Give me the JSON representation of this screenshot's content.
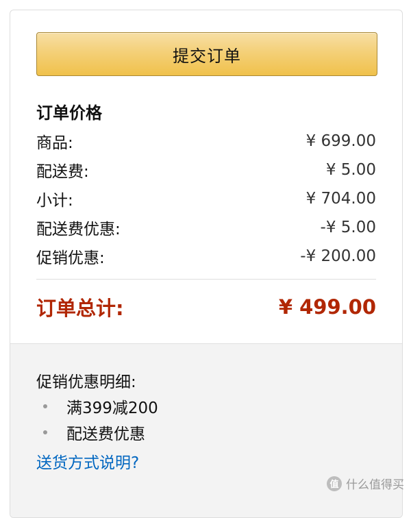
{
  "order": {
    "submit_label": "提交订单",
    "section_title": "订单价格",
    "rows": [
      {
        "label": "商品:",
        "amount": "¥ 699.00"
      },
      {
        "label": "配送费:",
        "amount": "¥ 5.00"
      },
      {
        "label": "小计:",
        "amount": "¥ 704.00"
      },
      {
        "label": "配送费优惠:",
        "amount": "-¥ 5.00"
      },
      {
        "label": "促销优惠:",
        "amount": "-¥ 200.00"
      }
    ],
    "total_label": "订单总计:",
    "total_amount": "¥ 499.00"
  },
  "promo": {
    "title": "促销优惠明细:",
    "items": [
      "满399减200",
      "配送费优惠"
    ],
    "shipping_link": "送货方式说明?"
  },
  "watermark": {
    "text": "什么值得买"
  },
  "colors": {
    "button": "#f0c14b",
    "total": "#b12704",
    "link": "#0066c0",
    "promo_bg": "#f3f3f3"
  },
  "icons": {
    "bullet": "dot-icon",
    "watermark_logo": "smzdm-logo-icon"
  }
}
